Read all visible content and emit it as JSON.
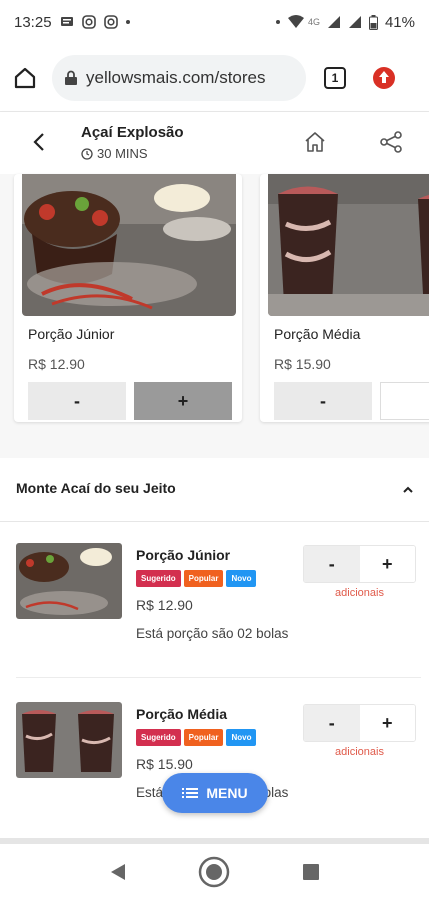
{
  "status_bar": {
    "time": "13:25",
    "network": "4G",
    "battery": "41%",
    "icons": [
      "message-icon",
      "instagram-icon",
      "instagram-icon",
      "wifi-icon",
      "signal-icon",
      "battery-icon"
    ]
  },
  "browser": {
    "url": "yellowsmais.com/stores",
    "tab_count": "1",
    "icons": [
      "home-icon",
      "lock-icon",
      "tabs-icon",
      "update-icon"
    ]
  },
  "store": {
    "name": "Açaí Explosão",
    "delivery_time": "30 MINS"
  },
  "carousel": [
    {
      "name": "Porção Júnior",
      "price": "R$ 12.90",
      "minus": "-",
      "plus": "+"
    },
    {
      "name": "Porção Média",
      "price": "R$ 15.90",
      "minus": "-",
      "plus": ""
    }
  ],
  "section": {
    "title": "Monte Acaí do seu Jeito"
  },
  "products": [
    {
      "name": "Porção Júnior",
      "badges": [
        "Sugerido",
        "Popular",
        "Novo"
      ],
      "price": "R$ 12.90",
      "description": "Está porção são 02 bolas",
      "minus": "-",
      "plus": "+",
      "extras": "adicionais"
    },
    {
      "name": "Porção Média",
      "badges": [
        "Sugerido",
        "Popular",
        "Novo"
      ],
      "price": "R$ 15.90",
      "description": "Está porção são 03 bolas",
      "minus": "-",
      "plus": "+",
      "extras": "adicionais"
    }
  ],
  "menu_button": "MENU",
  "colors": {
    "badge_sugerido": "#d32f4f",
    "badge_popular": "#f0611f",
    "badge_novo": "#2196f3",
    "menu_fab": "#4a86e8",
    "extras_text": "#e05a4a",
    "update_icon": "#d93025"
  }
}
